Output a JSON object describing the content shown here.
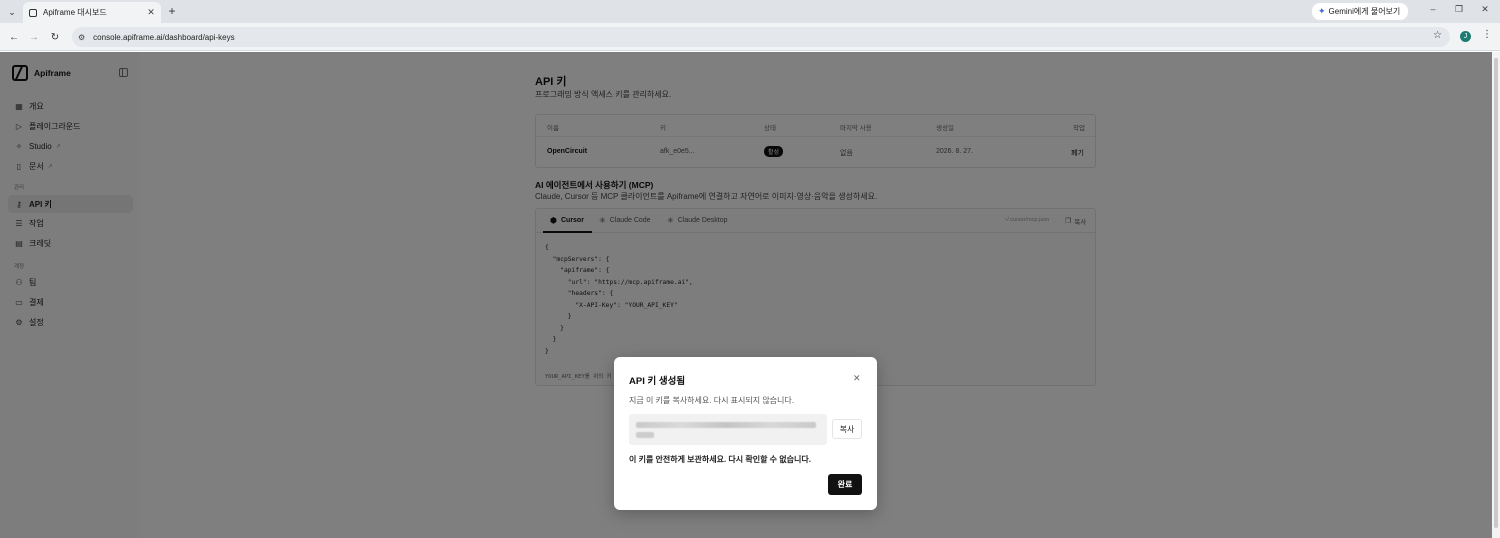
{
  "browser": {
    "tab_title": "Apiframe 대시보드",
    "url": "console.apiframe.ai/dashboard/api-keys",
    "gemini_label": "Gemini에게 물어보기",
    "profile_initial": "J"
  },
  "sidebar": {
    "brand": "Apiframe",
    "items_main": [
      {
        "label": "개요",
        "icon": "grid-icon"
      },
      {
        "label": "플레이그라운드",
        "icon": "play-icon"
      },
      {
        "label": "Studio",
        "icon": "wand-icon",
        "external": true
      },
      {
        "label": "문서",
        "icon": "book-icon",
        "external": true
      }
    ],
    "section_manage": "관리",
    "items_manage": [
      {
        "label": "API 키",
        "icon": "key-icon",
        "active": true
      },
      {
        "label": "작업",
        "icon": "list-icon"
      },
      {
        "label": "크레딧",
        "icon": "document-icon"
      }
    ],
    "section_account": "계정",
    "items_account": [
      {
        "label": "팀",
        "icon": "users-icon"
      },
      {
        "label": "결제",
        "icon": "card-icon"
      },
      {
        "label": "설정",
        "icon": "gear-icon"
      }
    ]
  },
  "page": {
    "title": "API 키",
    "subtitle": "프로그래밍 방식 액세스 키를 관리하세요."
  },
  "keys_table": {
    "columns": [
      "이름",
      "키",
      "상태",
      "마지막 사용",
      "생성일",
      "작업"
    ],
    "rows": [
      {
        "name": "OpenCircuit",
        "key": "afk_e0e5...",
        "status": "활성",
        "last_used": "없음",
        "created": "2026. 8. 27.",
        "action": "폐기"
      }
    ]
  },
  "mcp": {
    "title": "AI 에이전트에서 사용하기 (MCP)",
    "subtitle": "Claude, Cursor 등 MCP 클라이언트를 Apiframe에 연결하고 자연어로 이미지·영상·음악을 생성하세요.",
    "tabs": [
      "Cursor",
      "Claude Code",
      "Claude Desktop"
    ],
    "active_tab": "Cursor",
    "path": "~/.cursor/mcp.json",
    "copy_label": "복사",
    "code": "{\n  \"mcpServers\": {\n    \"apiframe\": {\n      \"url\": \"https://mcp.apiframe.ai\",\n      \"headers\": {\n        \"X-API-Key\": \"YOUR_API_KEY\"\n      }\n    }\n  }\n}",
    "note": "YOUR_API_KEY를 위의 키"
  },
  "modal": {
    "title": "API 키 생성됨",
    "description": "지금 이 키를 복사하세요. 다시 표시되지 않습니다.",
    "copy_label": "복사",
    "warning": "이 키를 안전하게 보관하세요. 다시 확인할 수 없습니다.",
    "done_label": "완료"
  }
}
